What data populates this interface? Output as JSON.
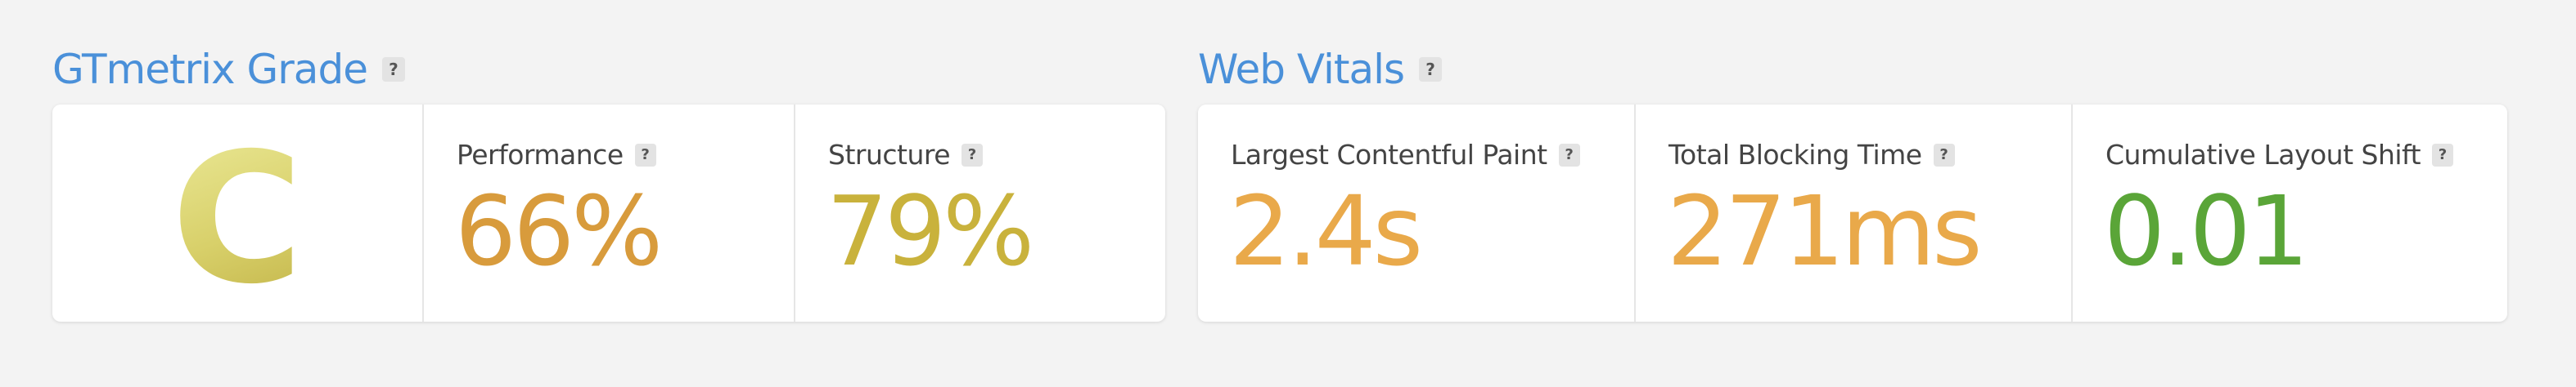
{
  "gtmetrix": {
    "title": "GTmetrix Grade",
    "help": "?",
    "grade": "C",
    "grade_color": "#d6cf6c",
    "metrics": [
      {
        "label": "Performance",
        "help": "?",
        "value": "66%",
        "color": "#d89b3c"
      },
      {
        "label": "Structure",
        "help": "?",
        "value": "79%",
        "color": "#c9b23c"
      }
    ]
  },
  "web_vitals": {
    "title": "Web Vitals",
    "help": "?",
    "metrics": [
      {
        "label": "Largest Contentful Paint",
        "help": "?",
        "value": "2.4s",
        "color": "#e9a94a"
      },
      {
        "label": "Total Blocking Time",
        "help": "?",
        "value": "271ms",
        "color": "#e9a94a"
      },
      {
        "label": "Cumulative Layout Shift",
        "help": "?",
        "value": "0.01",
        "color": "#5aa538"
      }
    ]
  }
}
